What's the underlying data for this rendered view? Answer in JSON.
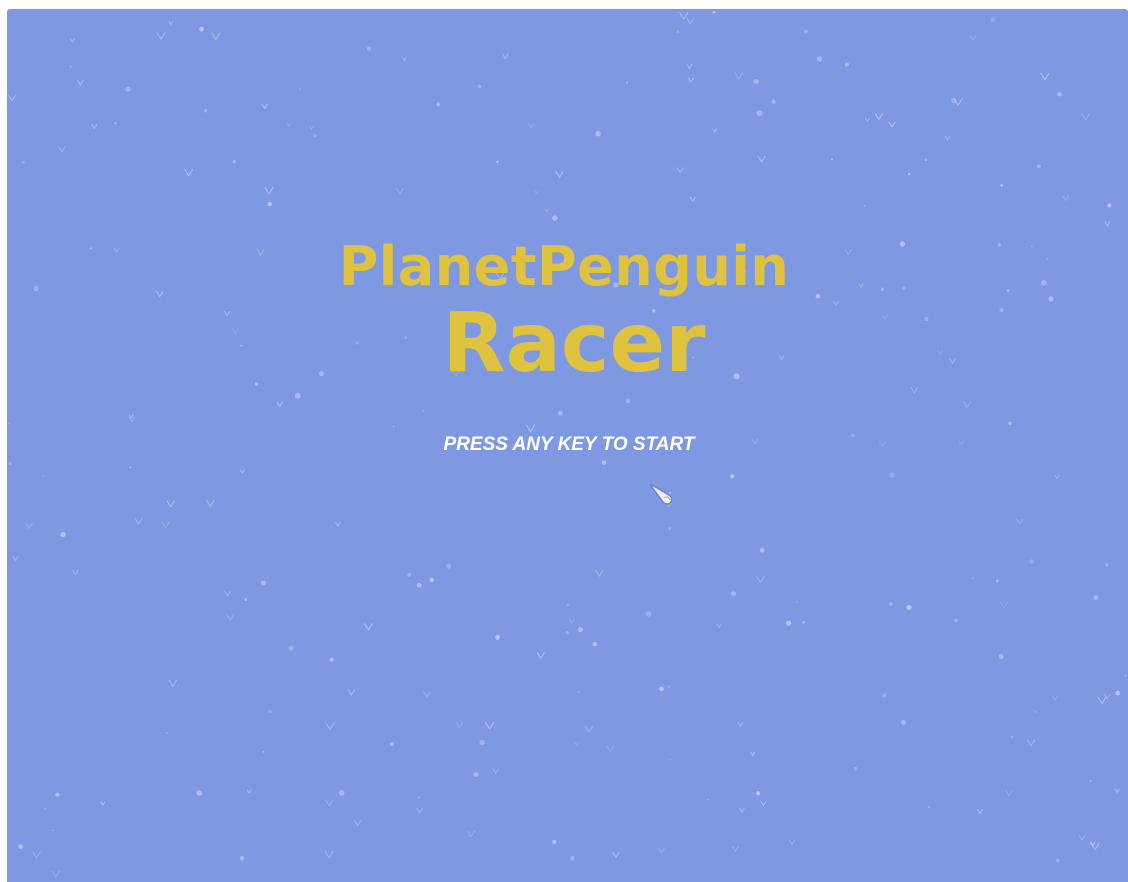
{
  "game": {
    "title_line_1": "PlanetPenguin",
    "title_line_2": "Racer",
    "prompt": "PRESS ANY KEY TO START"
  },
  "colors": {
    "background": "#7e98e2",
    "title": "#dfc23e",
    "prompt": "#ffffff",
    "snow": "#c3cff2"
  },
  "icons": {
    "cursor": "snowflake-cursor-icon"
  }
}
